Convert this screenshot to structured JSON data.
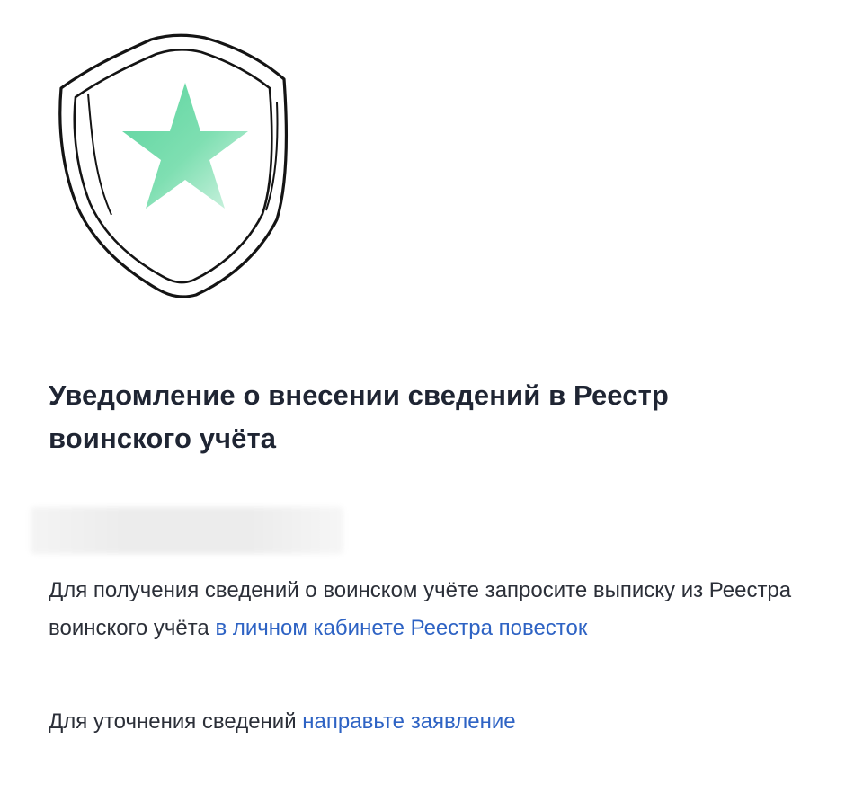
{
  "illustration": {
    "icon": "shield-star-icon",
    "star_color": "#5bd49e"
  },
  "notice": {
    "title": "Уведомление о внесении сведений в Реестр воинского учёта",
    "redacted_value": ""
  },
  "paragraph1": {
    "text": "Для получения сведений о воинском учёте запросите выписку из Реестра воинского учёта ",
    "link_label": "в личном кабинете Реестра повесток"
  },
  "paragraph2": {
    "text": "Для уточнения сведений ",
    "link_label": "направьте заявление"
  },
  "colors": {
    "link": "#2e63c4",
    "text": "#1f2533"
  }
}
